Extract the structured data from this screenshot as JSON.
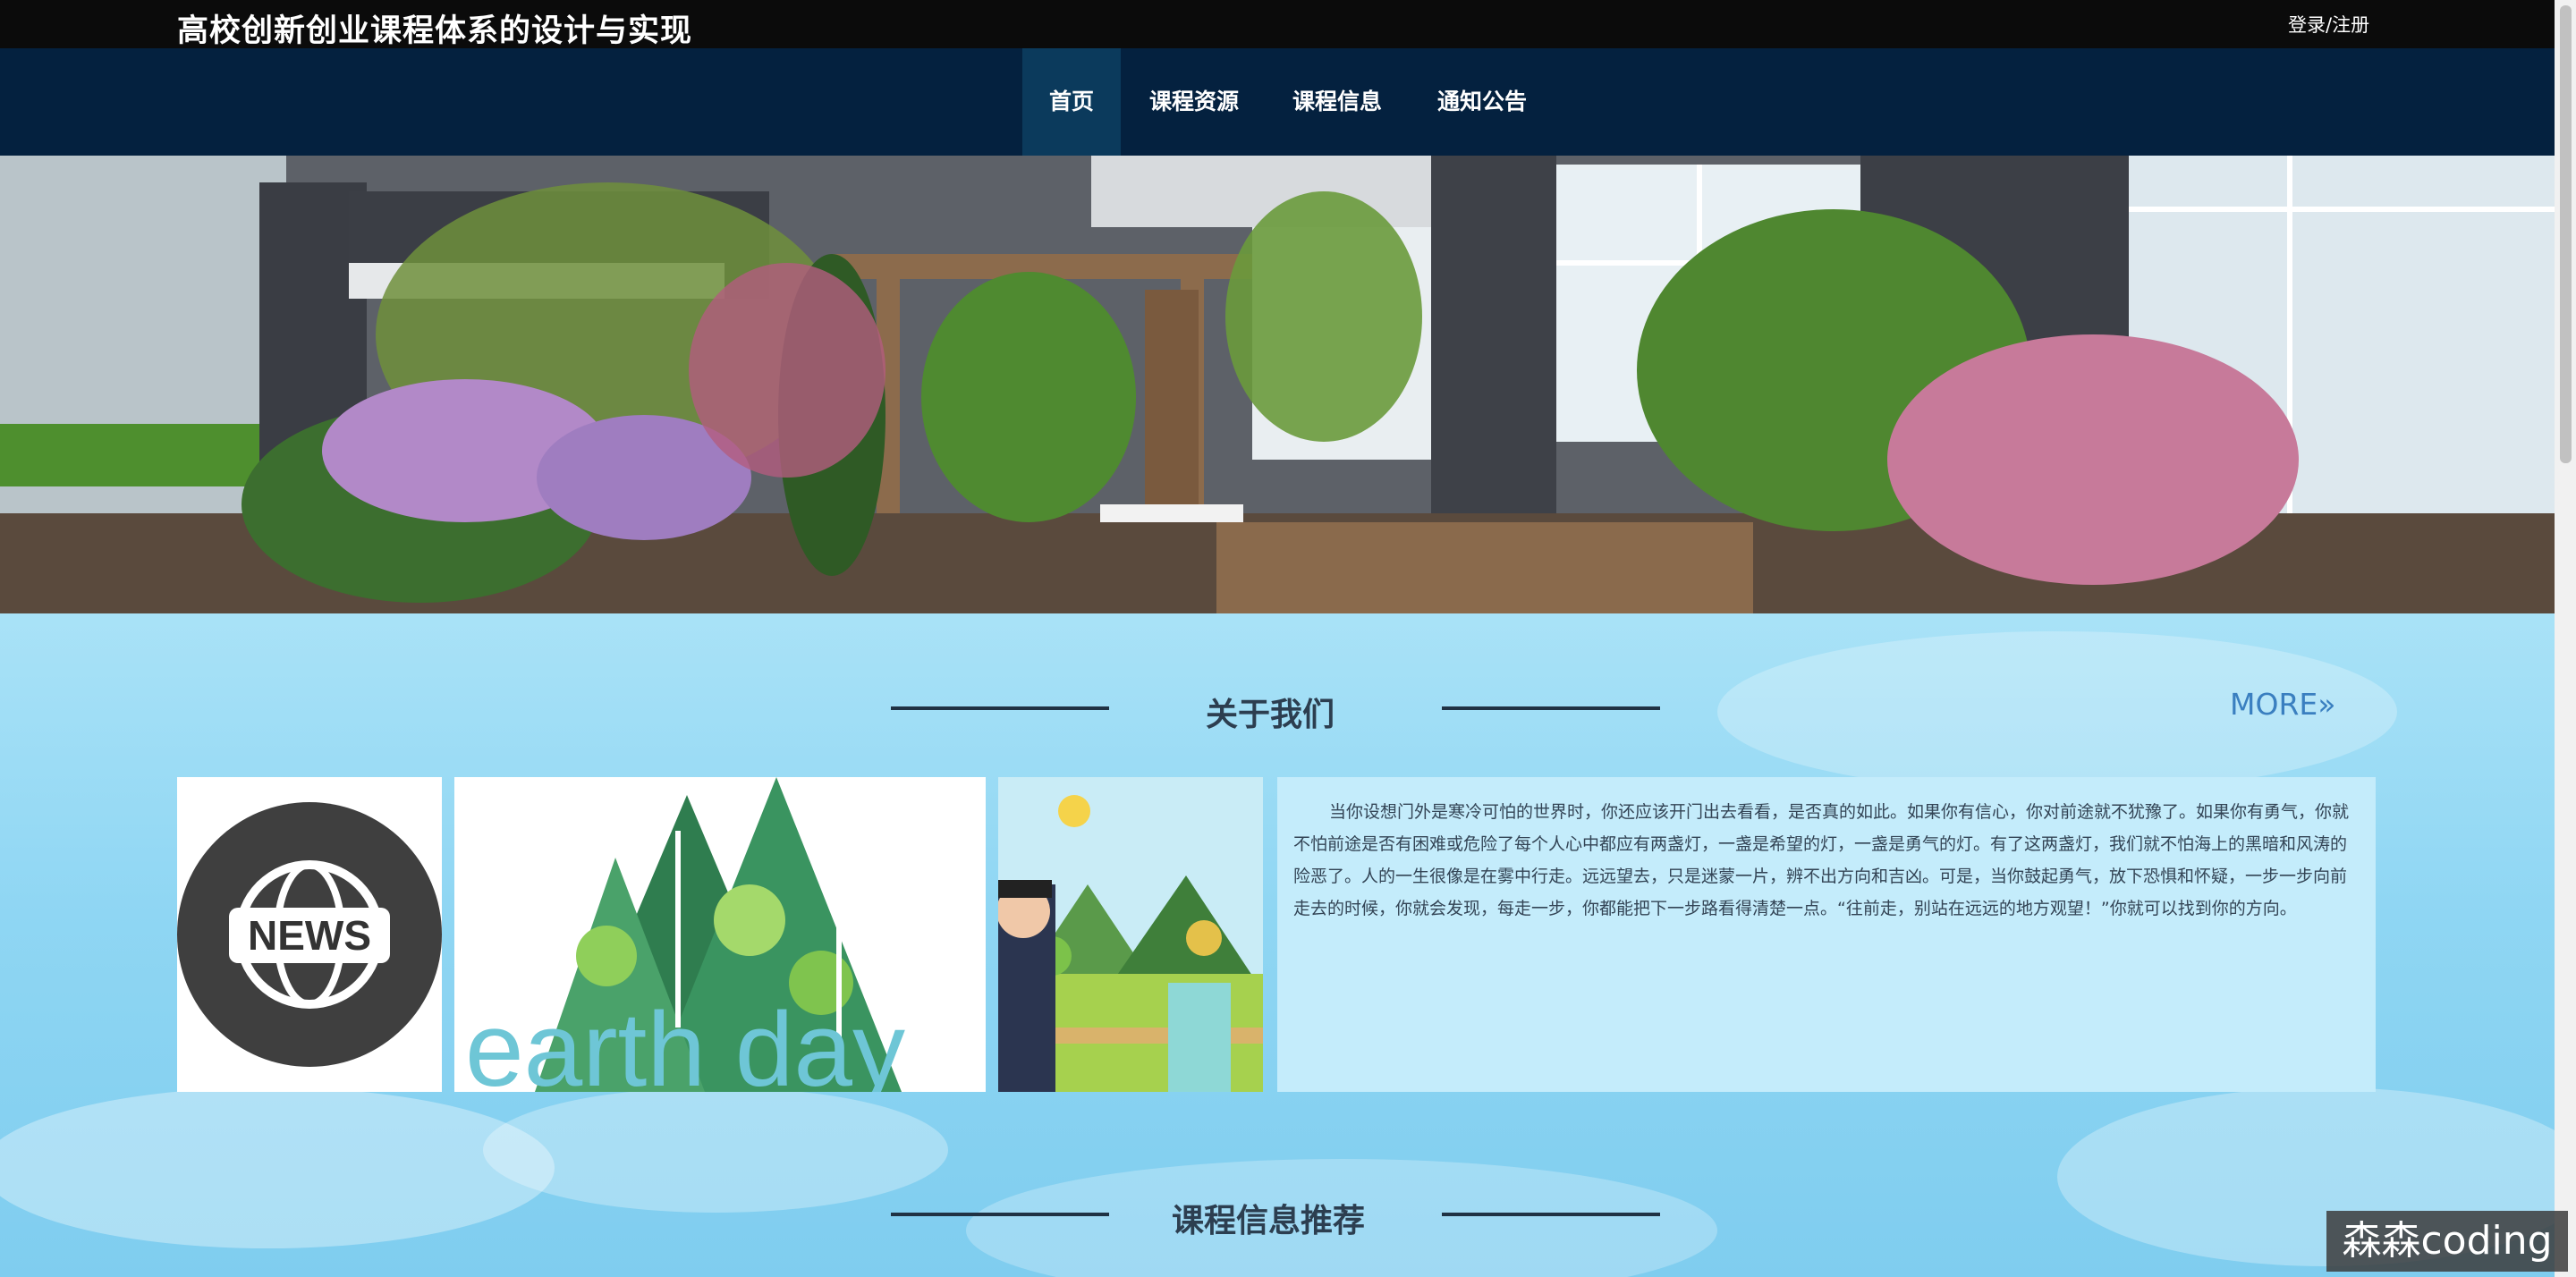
{
  "header": {
    "title": "高校创新创业课程体系的设计与实现",
    "login": "登录/注册"
  },
  "nav": {
    "items": [
      {
        "label": "首页",
        "active": true
      },
      {
        "label": "课程资源",
        "active": false
      },
      {
        "label": "课程信息",
        "active": false
      },
      {
        "label": "通知公告",
        "active": false
      }
    ]
  },
  "banner": {
    "slide_count": 3,
    "active_slide": 2
  },
  "about": {
    "title": "关于我们",
    "more": "MORE»",
    "news_label": "NEWS",
    "earth_label": "earth day",
    "text": "当你设想门外是寒冷可怕的世界时，你还应该开门出去看看，是否真的如此。如果你有信心，你对前途就不犹豫了。如果你有勇气，你就不怕前途是否有困难或危险了每个人心中都应有两盏灯，一盏是希望的灯，一盏是勇气的灯。有了这两盏灯，我们就不怕海上的黑暗和风涛的险恶了。人的一生很像是在雾中行走。远远望去，只是迷蒙一片，辨不出方向和吉凶。可是，当你鼓起勇气，放下恐惧和怀疑，一步一步向前走去的时候，你就会发现，每走一步，你都能把下一步路看得清楚一点。“往前走，别站在远远的地方观望！”你就可以找到你的方向。"
  },
  "course": {
    "title": "课程信息推荐"
  },
  "watermark": "森森coding",
  "colors": {
    "topbar": "#0b0b0b",
    "navbar": "#04213f",
    "nav_active": "#0b3a5c",
    "more": "#3a7fc0"
  }
}
